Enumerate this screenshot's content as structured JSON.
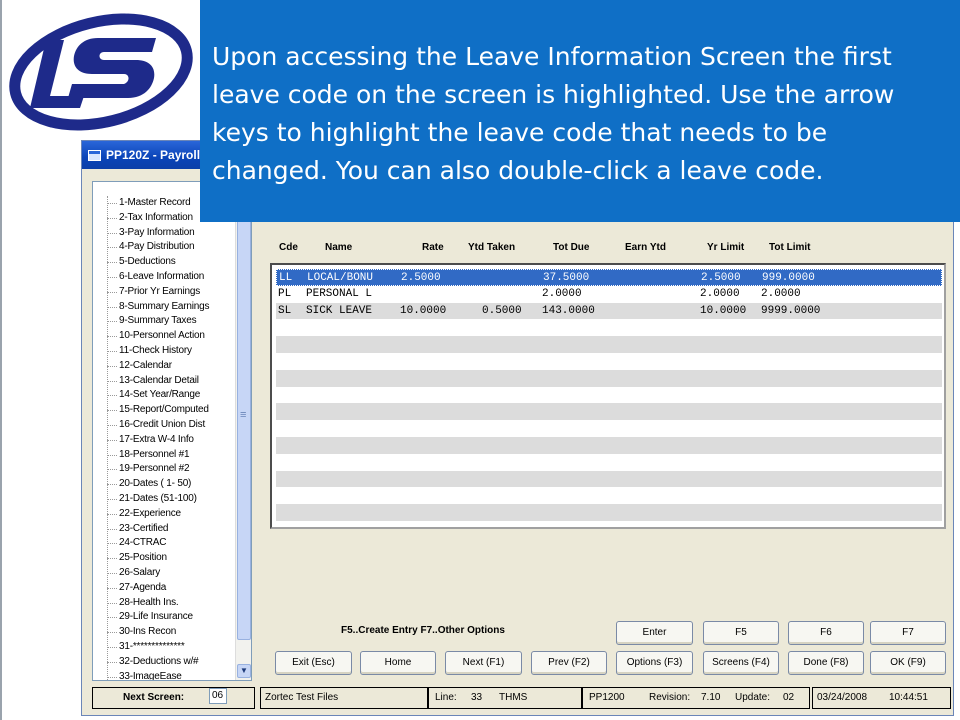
{
  "callout": {
    "text": "Upon accessing the Leave Information Screen the first leave code on the screen is highlighted.  Use the arrow keys to highlight the leave code that needs to be changed.  You can also double-click a leave code."
  },
  "window": {
    "title": "PP120Z - Payroll"
  },
  "tree": {
    "items": [
      "1-Master Record",
      "2-Tax Information",
      "3-Pay Information",
      "4-Pay Distribution",
      "5-Deductions",
      "6-Leave Information",
      "7-Prior Yr Earnings",
      "8-Summary Earnings",
      "9-Summary Taxes",
      "10-Personnel Action",
      "11-Check History",
      "12-Calendar",
      "13-Calendar Detail",
      "14-Set Year/Range",
      "15-Report/Computed",
      "16-Credit Union Dist",
      "17-Extra W-4 Info",
      "18-Personnel #1",
      "19-Personnel #2",
      "20-Dates ( 1- 50)",
      "21-Dates (51-100)",
      "22-Experience",
      "23-Certified",
      "24-CTRAC",
      "25-Position",
      "26-Salary",
      "27-Agenda",
      "28-Health Ins.",
      "29-Life Insurance",
      "30-Ins Recon",
      "31-**************",
      "32-Deductions w/#",
      "33-ImageEase"
    ]
  },
  "grid": {
    "columns": [
      "Cde",
      "Name",
      "Rate",
      "Ytd Taken",
      "Tot Due",
      "Earn Ytd",
      "Yr Limit",
      "Tot Limit"
    ],
    "rows": [
      {
        "cde": "LL",
        "name": "LOCAL/BONU",
        "rate": "2.5000",
        "ytd_taken": "",
        "tot_due": "37.5000",
        "earn_ytd": "",
        "yr_limit": "2.5000",
        "tot_limit": "999.0000"
      },
      {
        "cde": "PL",
        "name": "PERSONAL L",
        "rate": "",
        "ytd_taken": "",
        "tot_due": "2.0000",
        "earn_ytd": "",
        "yr_limit": "2.0000",
        "tot_limit": "2.0000"
      },
      {
        "cde": "SL",
        "name": "SICK LEAVE",
        "rate": "10.0000",
        "ytd_taken": "0.5000",
        "tot_due": "143.0000",
        "earn_ytd": "",
        "yr_limit": "10.0000",
        "tot_limit": "9999.0000"
      }
    ],
    "selected_row": 0
  },
  "hint": "F5..Create Entry  F7..Other Options",
  "buttons": {
    "enter": "Enter",
    "f5": "F5",
    "f6": "F6",
    "f7": "F7",
    "exit": "Exit (Esc)",
    "home": "Home",
    "next": "Next (F1)",
    "prev": "Prev (F2)",
    "options": "Options (F3)",
    "screens": "Screens (F4)",
    "done": "Done (F8)",
    "ok": "OK (F9)"
  },
  "status": {
    "next_screen_label": "Next Screen:",
    "next_screen_value": "06",
    "db": "Zortec Test Files",
    "line_label": "Line:",
    "line_value": "33",
    "user": "THMS",
    "program": "PP1200",
    "revision_label": "Revision:",
    "revision_value": "7.10",
    "update_label": "Update:",
    "update_value": "02",
    "date": "03/24/2008",
    "time": "10:44:51"
  },
  "colors": {
    "callout_bg": "#0f6fc6",
    "selection": "#316ac5",
    "logo": "#1e2a8a"
  }
}
